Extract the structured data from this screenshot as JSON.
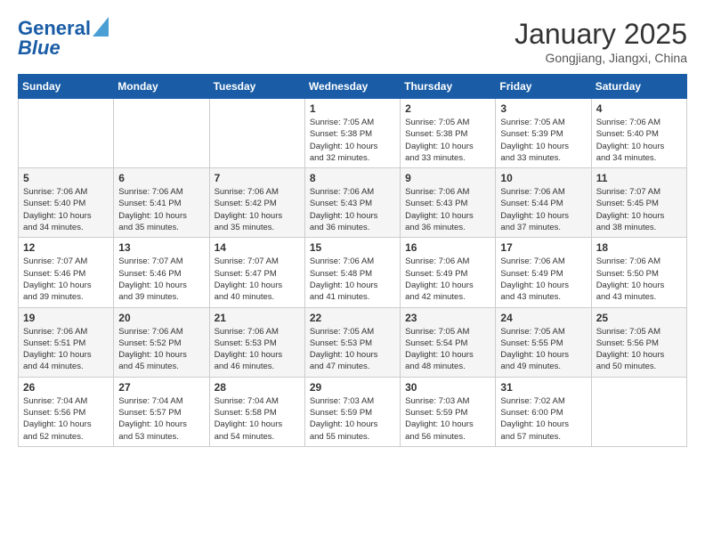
{
  "logo": {
    "line1": "General",
    "line2": "Blue"
  },
  "title": "January 2025",
  "subtitle": "Gongjiang, Jiangxi, China",
  "days_of_week": [
    "Sunday",
    "Monday",
    "Tuesday",
    "Wednesday",
    "Thursday",
    "Friday",
    "Saturday"
  ],
  "weeks": [
    [
      {
        "day": "",
        "info": ""
      },
      {
        "day": "",
        "info": ""
      },
      {
        "day": "",
        "info": ""
      },
      {
        "day": "1",
        "info": "Sunrise: 7:05 AM\nSunset: 5:38 PM\nDaylight: 10 hours\nand 32 minutes."
      },
      {
        "day": "2",
        "info": "Sunrise: 7:05 AM\nSunset: 5:38 PM\nDaylight: 10 hours\nand 33 minutes."
      },
      {
        "day": "3",
        "info": "Sunrise: 7:05 AM\nSunset: 5:39 PM\nDaylight: 10 hours\nand 33 minutes."
      },
      {
        "day": "4",
        "info": "Sunrise: 7:06 AM\nSunset: 5:40 PM\nDaylight: 10 hours\nand 34 minutes."
      }
    ],
    [
      {
        "day": "5",
        "info": "Sunrise: 7:06 AM\nSunset: 5:40 PM\nDaylight: 10 hours\nand 34 minutes."
      },
      {
        "day": "6",
        "info": "Sunrise: 7:06 AM\nSunset: 5:41 PM\nDaylight: 10 hours\nand 35 minutes."
      },
      {
        "day": "7",
        "info": "Sunrise: 7:06 AM\nSunset: 5:42 PM\nDaylight: 10 hours\nand 35 minutes."
      },
      {
        "day": "8",
        "info": "Sunrise: 7:06 AM\nSunset: 5:43 PM\nDaylight: 10 hours\nand 36 minutes."
      },
      {
        "day": "9",
        "info": "Sunrise: 7:06 AM\nSunset: 5:43 PM\nDaylight: 10 hours\nand 36 minutes."
      },
      {
        "day": "10",
        "info": "Sunrise: 7:06 AM\nSunset: 5:44 PM\nDaylight: 10 hours\nand 37 minutes."
      },
      {
        "day": "11",
        "info": "Sunrise: 7:07 AM\nSunset: 5:45 PM\nDaylight: 10 hours\nand 38 minutes."
      }
    ],
    [
      {
        "day": "12",
        "info": "Sunrise: 7:07 AM\nSunset: 5:46 PM\nDaylight: 10 hours\nand 39 minutes."
      },
      {
        "day": "13",
        "info": "Sunrise: 7:07 AM\nSunset: 5:46 PM\nDaylight: 10 hours\nand 39 minutes."
      },
      {
        "day": "14",
        "info": "Sunrise: 7:07 AM\nSunset: 5:47 PM\nDaylight: 10 hours\nand 40 minutes."
      },
      {
        "day": "15",
        "info": "Sunrise: 7:06 AM\nSunset: 5:48 PM\nDaylight: 10 hours\nand 41 minutes."
      },
      {
        "day": "16",
        "info": "Sunrise: 7:06 AM\nSunset: 5:49 PM\nDaylight: 10 hours\nand 42 minutes."
      },
      {
        "day": "17",
        "info": "Sunrise: 7:06 AM\nSunset: 5:49 PM\nDaylight: 10 hours\nand 43 minutes."
      },
      {
        "day": "18",
        "info": "Sunrise: 7:06 AM\nSunset: 5:50 PM\nDaylight: 10 hours\nand 43 minutes."
      }
    ],
    [
      {
        "day": "19",
        "info": "Sunrise: 7:06 AM\nSunset: 5:51 PM\nDaylight: 10 hours\nand 44 minutes."
      },
      {
        "day": "20",
        "info": "Sunrise: 7:06 AM\nSunset: 5:52 PM\nDaylight: 10 hours\nand 45 minutes."
      },
      {
        "day": "21",
        "info": "Sunrise: 7:06 AM\nSunset: 5:53 PM\nDaylight: 10 hours\nand 46 minutes."
      },
      {
        "day": "22",
        "info": "Sunrise: 7:05 AM\nSunset: 5:53 PM\nDaylight: 10 hours\nand 47 minutes."
      },
      {
        "day": "23",
        "info": "Sunrise: 7:05 AM\nSunset: 5:54 PM\nDaylight: 10 hours\nand 48 minutes."
      },
      {
        "day": "24",
        "info": "Sunrise: 7:05 AM\nSunset: 5:55 PM\nDaylight: 10 hours\nand 49 minutes."
      },
      {
        "day": "25",
        "info": "Sunrise: 7:05 AM\nSunset: 5:56 PM\nDaylight: 10 hours\nand 50 minutes."
      }
    ],
    [
      {
        "day": "26",
        "info": "Sunrise: 7:04 AM\nSunset: 5:56 PM\nDaylight: 10 hours\nand 52 minutes."
      },
      {
        "day": "27",
        "info": "Sunrise: 7:04 AM\nSunset: 5:57 PM\nDaylight: 10 hours\nand 53 minutes."
      },
      {
        "day": "28",
        "info": "Sunrise: 7:04 AM\nSunset: 5:58 PM\nDaylight: 10 hours\nand 54 minutes."
      },
      {
        "day": "29",
        "info": "Sunrise: 7:03 AM\nSunset: 5:59 PM\nDaylight: 10 hours\nand 55 minutes."
      },
      {
        "day": "30",
        "info": "Sunrise: 7:03 AM\nSunset: 5:59 PM\nDaylight: 10 hours\nand 56 minutes."
      },
      {
        "day": "31",
        "info": "Sunrise: 7:02 AM\nSunset: 6:00 PM\nDaylight: 10 hours\nand 57 minutes."
      },
      {
        "day": "",
        "info": ""
      }
    ]
  ]
}
